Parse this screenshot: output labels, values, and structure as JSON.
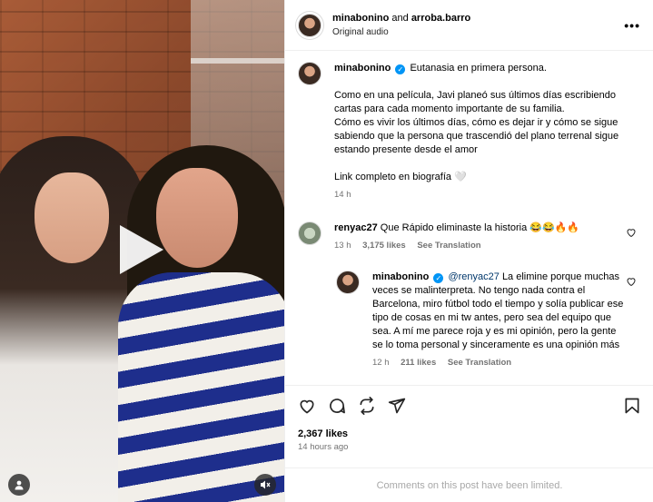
{
  "post": {
    "header": {
      "username": "minabonino",
      "and_text": "and",
      "collaborator": "arroba.barro",
      "audio": "Original audio",
      "more_label": "•••"
    },
    "caption": {
      "username": "minabonino",
      "title": "Eutanasia en primera persona.",
      "paragraph1": "Como en una película, Javi planeó sus últimos días escribiendo cartas para cada momento importante de su familia.",
      "paragraph2": "Cómo es vivir los últimos días, cómo es dejar ir y cómo se sigue sabiendo que la persona que trascendió del plano terrenal sigue estando presente desde el amor",
      "link_text": "Link completo en biografía 🤍",
      "time": "14 h"
    },
    "comments": [
      {
        "username": "renyac27",
        "text": "Que Rápido eliminaste la historia 😂😂🔥🔥",
        "time": "13 h",
        "likes": "3,175 likes",
        "translate": "See Translation"
      }
    ],
    "reply": {
      "username": "minabonino",
      "mention": "@renyac27",
      "text": "La elimine porque muchas veces se malinterpreta. No tengo nada contra el Barcelona, miro fútbol todo el tiempo y solía publicar ese tipo de cosas en mi tw antes, pero sea del equipo que sea. A mí me parece roja y es mi opinión, pero la gente se lo toma personal y sinceramente es una opinión más",
      "time": "12 h",
      "likes": "211 likes",
      "translate": "See Translation"
    },
    "likes_count": "2,367 likes",
    "posted_ago": "14 hours ago",
    "limited_notice": "Comments on this post have been limited."
  },
  "colors": {
    "verified": "#0095f6",
    "mention": "#00376b",
    "muted_text": "#737373"
  },
  "icons": [
    "heart-icon",
    "comment-icon",
    "share-icon",
    "send-icon",
    "bookmark-icon",
    "play-icon",
    "user-tag-icon",
    "mute-icon",
    "verified-icon"
  ]
}
